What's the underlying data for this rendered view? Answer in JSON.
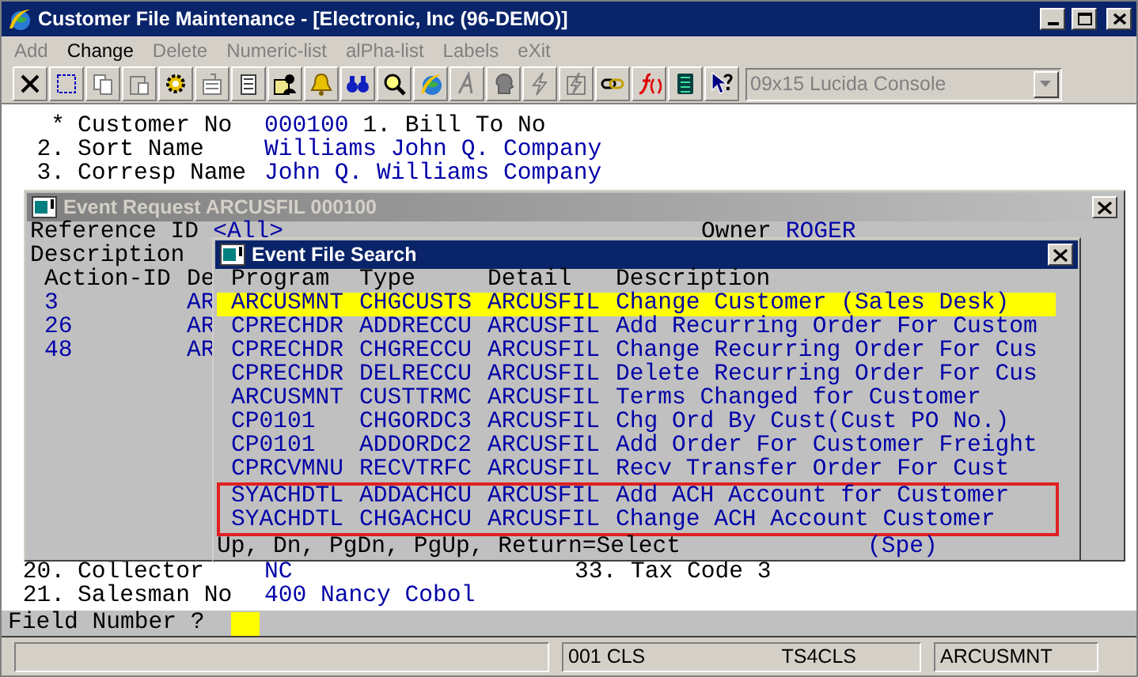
{
  "window": {
    "title": "Customer File Maintenance - [Electronic, Inc (96-DEMO)]"
  },
  "menu": [
    {
      "label": "Add",
      "disabled": true
    },
    {
      "label": "Change",
      "disabled": false
    },
    {
      "label": "Delete",
      "disabled": true
    },
    {
      "label": "Numeric-list",
      "disabled": true
    },
    {
      "label": "alPha-list",
      "disabled": true
    },
    {
      "label": "Labels",
      "disabled": true
    },
    {
      "label": "eXit",
      "disabled": true
    }
  ],
  "toolbar": [
    {
      "kind": "close",
      "disabled": false
    },
    {
      "kind": "select",
      "disabled": false
    },
    {
      "kind": "copy",
      "disabled": true
    },
    {
      "kind": "paste",
      "disabled": true
    },
    {
      "kind": "gear",
      "disabled": false
    },
    {
      "kind": "properties",
      "disabled": true
    },
    {
      "kind": "list",
      "disabled": false
    },
    {
      "kind": "card",
      "disabled": false
    },
    {
      "kind": "bell",
      "disabled": false
    },
    {
      "kind": "binoculars",
      "disabled": false
    },
    {
      "kind": "magnifier",
      "disabled": false
    },
    {
      "kind": "globe",
      "disabled": false
    },
    {
      "kind": "letter",
      "disabled": true
    },
    {
      "kind": "head",
      "disabled": true
    },
    {
      "kind": "lightning",
      "disabled": true
    },
    {
      "kind": "lightning-page",
      "disabled": true
    },
    {
      "kind": "link",
      "disabled": false
    },
    {
      "kind": "function",
      "disabled": false
    },
    {
      "kind": "calculator",
      "disabled": false
    },
    {
      "kind": "help",
      "disabled": false
    }
  ],
  "font_combo": {
    "value": "09x15 Lucida Console",
    "disabled": true
  },
  "fields_top": [
    {
      "number": "*",
      "label": "Customer No",
      "value": "000100",
      "extra": "1. Bill To No"
    },
    {
      "number": "2.",
      "label": "Sort Name",
      "value": "Williams John Q. Company"
    },
    {
      "number": "3.",
      "label": "Corresp Name",
      "value": "John Q. Williams Company"
    }
  ],
  "fields_bottom": [
    {
      "number": "20.",
      "label": "Collector",
      "value": "NC",
      "extra": "33. Tax Code 3"
    },
    {
      "number": "21.",
      "label": "Salesman No",
      "value": "400 Nancy Cobol"
    }
  ],
  "prompt": {
    "label": "Field Number ?"
  },
  "status_bar": {
    "panel_1": "001 CLS",
    "panel_2": "TS4CLS",
    "panel_3": "ARCUSMNT"
  },
  "event_request": {
    "title": "Event Request ARCUSFIL 000100",
    "reference_label": "Reference ID",
    "reference_value": "<All>",
    "owner_label": "Owner",
    "owner_value": "ROGER",
    "description_label": "Description",
    "columns": [
      "Action-ID",
      "De"
    ],
    "rows": [
      {
        "action_id": "3",
        "column_2": "AR"
      },
      {
        "action_id": "26",
        "column_2": "AR"
      },
      {
        "action_id": "48",
        "column_2": "AR"
      }
    ]
  },
  "event_search": {
    "title": "Event File Search",
    "columns": [
      "Program",
      "Type",
      "Detail",
      "Description"
    ],
    "rows": [
      {
        "program": "ARCUSMNT",
        "type": "CHGCUSTS",
        "detail": "ARCUSFIL",
        "description": "Change Customer (Sales Desk)",
        "selected": true
      },
      {
        "program": "CPRECHDR",
        "type": "ADDRECCU",
        "detail": "ARCUSFIL",
        "description": "Add Recurring Order For Custom",
        "selected": false
      },
      {
        "program": "CPRECHDR",
        "type": "CHGRECCU",
        "detail": "ARCUSFIL",
        "description": "Change Recurring Order For Cus",
        "selected": false
      },
      {
        "program": "CPRECHDR",
        "type": "DELRECCU",
        "detail": "ARCUSFIL",
        "description": "Delete Recurring Order For Cus",
        "selected": false
      },
      {
        "program": "ARCUSMNT",
        "type": "CUSTTRMC",
        "detail": "ARCUSFIL",
        "description": "Terms Changed for Customer",
        "selected": false
      },
      {
        "program": "CP0101",
        "type": "CHGORDC3",
        "detail": "ARCUSFIL",
        "description": "Chg Ord By Cust(Cust PO No.)",
        "selected": false
      },
      {
        "program": "CP0101",
        "type": "ADDORDC2",
        "detail": "ARCUSFIL",
        "description": "Add Order For Customer Freight",
        "selected": false
      },
      {
        "program": "CPRCVMNU",
        "type": "RECVTRFC",
        "detail": "ARCUSFIL",
        "description": "Recv Transfer Order For Cust",
        "selected": false
      },
      {
        "program": "SYACHDTL",
        "type": "ADDACHCU",
        "detail": "ARCUSFIL",
        "description": "Add ACH Account for Customer",
        "selected": false,
        "highlighted": true
      },
      {
        "program": "SYACHDTL",
        "type": "CHGACHCU",
        "detail": "ARCUSFIL",
        "description": "Change ACH Account Customer",
        "selected": false,
        "highlighted": true
      }
    ],
    "footer": "Up, Dn, PgDn, PgUp, Return=Select",
    "footer_hint": "(Spe)"
  }
}
